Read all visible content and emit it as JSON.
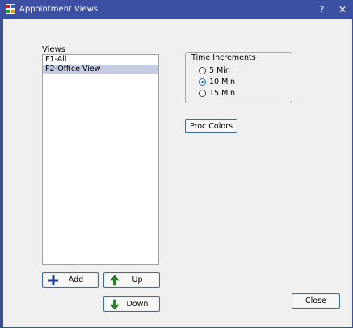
{
  "window": {
    "title": "Appointment Views",
    "help_label": "?",
    "close_label": "✕"
  },
  "views": {
    "label": "Views",
    "items": [
      {
        "label": "F1-All",
        "selected": false
      },
      {
        "label": "F2-Office View",
        "selected": true
      }
    ]
  },
  "time_increments": {
    "legend": "Time Increments",
    "options": [
      {
        "label": "5 Min",
        "checked": false
      },
      {
        "label": "10 Min",
        "checked": true
      },
      {
        "label": "15 Min",
        "checked": false
      }
    ]
  },
  "buttons": {
    "proc_colors": "Proc Colors",
    "add": "Add",
    "up": "Up",
    "down": "Down",
    "close": "Close"
  },
  "icons": {
    "add": "plus-icon",
    "up": "up-arrow-icon",
    "down": "down-arrow-icon"
  },
  "colors": {
    "titlebar": "#3d4fa3",
    "selection": "#c5cbe0",
    "plus": "#1f3f9a",
    "arrow": "#1e8a1e"
  }
}
